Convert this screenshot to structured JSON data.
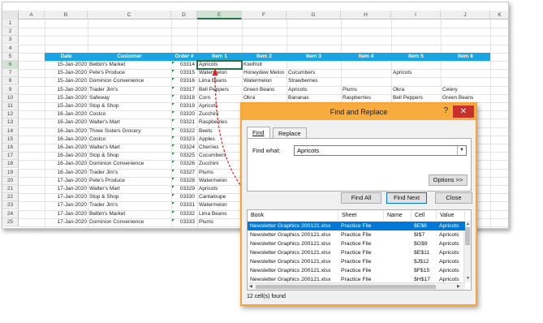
{
  "columns": [
    "A",
    "B",
    "C",
    "D",
    "E",
    "F",
    "G",
    "H",
    "I",
    "J",
    "K"
  ],
  "rows": [
    "1",
    "2",
    "3",
    "4",
    "5",
    "6",
    "7",
    "8",
    "9",
    "10",
    "11",
    "12",
    "13",
    "14",
    "15",
    "16",
    "17",
    "18",
    "19",
    "20",
    "21",
    "22",
    "23",
    "24",
    "25"
  ],
  "watermark": "©TheExcelAddict.com",
  "table": {
    "headers": [
      "Date",
      "Customer",
      "Order #",
      "Item 1",
      "Item 2",
      "Item 3",
      "Item 4",
      "Item 5",
      "Item 6"
    ],
    "rows": [
      [
        "15-Jan-2020",
        "Belbin's Market",
        "03314",
        "Apricots",
        "Kiwifruit",
        "",
        "",
        "",
        ""
      ],
      [
        "15-Jan-2020",
        "Pete's Produce",
        "03315",
        "Watermelon",
        "Honeydew Melon",
        "Cucumbers",
        "",
        "Apricots",
        ""
      ],
      [
        "15-Jan-2020",
        "Dominion Convenience",
        "03316",
        "Lima Beans",
        "Watermelon",
        "Strawberries",
        "",
        "",
        ""
      ],
      [
        "15-Jan-2020",
        "Trader Jim's",
        "03317",
        "Bell Peppers",
        "Green Beans",
        "Apricots",
        "Plums",
        "Okra",
        "Celery"
      ],
      [
        "15-Jan-2020",
        "Safeway",
        "03318",
        "Corn",
        "Okra",
        "Bananas",
        "Raspberries",
        "Bell Peppers",
        "Green Beans"
      ],
      [
        "15-Jan-2020",
        "Stop & Shop",
        "03319",
        "Apricots",
        "",
        "",
        "",
        "",
        ""
      ],
      [
        "16-Jan-2020",
        "Costco",
        "03320",
        "Zucchini",
        "",
        "",
        "",
        "",
        ""
      ],
      [
        "16-Jan-2020",
        "Walter's Mart",
        "03321",
        "Raspberries",
        "",
        "",
        "",
        "",
        ""
      ],
      [
        "16-Jan-2020",
        "Three Sisters Grocery",
        "03322",
        "Beets",
        "",
        "",
        "",
        "",
        ""
      ],
      [
        "16-Jan-2020",
        "Costco",
        "03323",
        "Apples",
        "",
        "",
        "",
        "",
        ""
      ],
      [
        "16-Jan-2020",
        "Walter's Mart",
        "03324",
        "Cherries",
        "",
        "",
        "",
        "",
        ""
      ],
      [
        "16-Jan-2020",
        "Stop & Shop",
        "03325",
        "Cucumbers",
        "",
        "",
        "",
        "",
        ""
      ],
      [
        "16-Jan-2020",
        "Dominion Convenience",
        "03326",
        "Zucchini",
        "",
        "",
        "",
        "",
        ""
      ],
      [
        "16-Jan-2020",
        "Trader Jim's",
        "03327",
        "Plums",
        "",
        "",
        "",
        "",
        ""
      ],
      [
        "17-Jan-2020",
        "Pete's Produce",
        "03328",
        "Watermelon",
        "",
        "",
        "",
        "",
        ""
      ],
      [
        "17-Jan-2020",
        "Walter's Mart",
        "03329",
        "Apricots",
        "",
        "",
        "",
        "",
        ""
      ],
      [
        "17-Jan-2020",
        "Stop & Shop",
        "03330",
        "Cantaloupe",
        "",
        "",
        "",
        "",
        ""
      ],
      [
        "17-Jan-2020",
        "Trader Jim's",
        "03331",
        "Watermelon",
        "",
        "",
        "",
        "",
        ""
      ],
      [
        "17-Jan-2020",
        "Belbin's Market",
        "03332",
        "Lima Beans",
        "",
        "",
        "",
        "",
        ""
      ],
      [
        "17-Jan-2020",
        "Dominion Convenience",
        "03333",
        "Plums",
        "",
        "",
        "",
        "",
        ""
      ]
    ]
  },
  "dialog": {
    "title": "Find and Replace",
    "help": "?",
    "close": "✕",
    "tab_find": "Find",
    "tab_replace": "Replace",
    "find_label": "Find what:",
    "find_value": "Apricots",
    "options_button": "Options >>",
    "find_all_button": "Find All",
    "find_next_button": "Find Next",
    "close_button": "Close",
    "result_headers": [
      "Book",
      "Sheet",
      "Name",
      "Cell",
      "Value"
    ],
    "results": [
      [
        "Newsletter Graphics 200121.xlsx",
        "Practice File",
        "",
        "$E$6",
        "Apricots"
      ],
      [
        "Newsletter Graphics 200121.xlsx",
        "Practice File",
        "",
        "$I$7",
        "Apricots"
      ],
      [
        "Newsletter Graphics 200121.xlsx",
        "Practice File",
        "",
        "$G$9",
        "Apricots"
      ],
      [
        "Newsletter Graphics 200121.xlsx",
        "Practice File",
        "",
        "$E$11",
        "Apricots"
      ],
      [
        "Newsletter Graphics 200121.xlsx",
        "Practice File",
        "",
        "$J$12",
        "Apricots"
      ],
      [
        "Newsletter Graphics 200121.xlsx",
        "Practice File",
        "",
        "$F$15",
        "Apricots"
      ],
      [
        "Newsletter Graphics 200121.xlsx",
        "Practice File",
        "",
        "$H$17",
        "Apricots"
      ]
    ],
    "status": "12 cell(s) found"
  },
  "colors": {
    "header_blue": "#1aa4e3",
    "dialog_orange": "#f9ac3e",
    "select_blue": "#0078d7",
    "excel_green": "#217346",
    "arrow_red": "#e02020"
  }
}
